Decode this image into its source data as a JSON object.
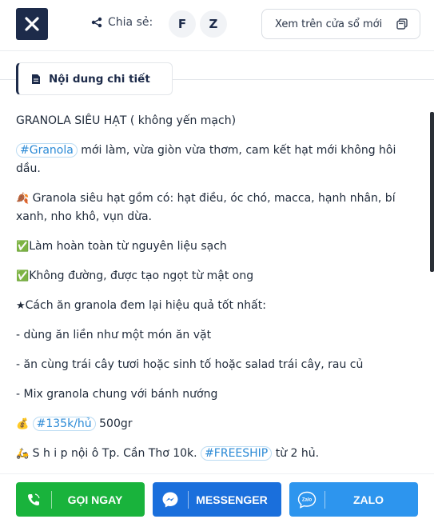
{
  "header": {
    "share_label": "Chia sẻ:",
    "share_facebook": "F",
    "share_zalo": "Z",
    "open_new_window": "Xem trên cửa sổ mới"
  },
  "tab": {
    "label": "Nội dung chi tiết"
  },
  "content": {
    "title": "GRANOLA SIÊU HẠT ( không yến mạch)",
    "tag1": "#Granola",
    "line1_rest": "mới làm, vừa giòn vừa thơm, cam kết hạt mới không hôi dầu.",
    "line2": "Granola siêu hạt gồm có: hạt điều, óc chó, macca, hạnh nhân, bí xanh, nho khô, vụn dừa.",
    "line3": "Làm hoàn toàn từ nguyên liệu sạch",
    "line4": "Không đường, được tạo ngọt từ mật ong",
    "line5": "Cách ăn granola đem lại hiệu quả tốt nhất:",
    "line6": "- dùng ăn liền như một món ăn vặt",
    "line7": "- ăn cùng trái cây tươi hoặc sinh tố hoặc salad trái cây, rau củ",
    "line8": "- Mix granola chung với bánh nướng",
    "price_tag": "#135k/hủ",
    "price_rest": "500gr",
    "ship_text": "S h i p nội ô Tp. Cần Thơ 10k.",
    "freeship_tag": "#FREESHIP",
    "ship_rest": "từ 2 hủ."
  },
  "footer": {
    "call": "GỌI NGAY",
    "messenger": "MESSENGER",
    "zalo": "ZALO",
    "zalo_icon_text": "Zalo"
  },
  "colors": {
    "navy": "#1d2b4a",
    "call_green": "#19b33c",
    "messenger_blue": "#1a6fdc",
    "zalo_blue": "#2d95ee",
    "tag_blue": "#2b8ad6"
  }
}
